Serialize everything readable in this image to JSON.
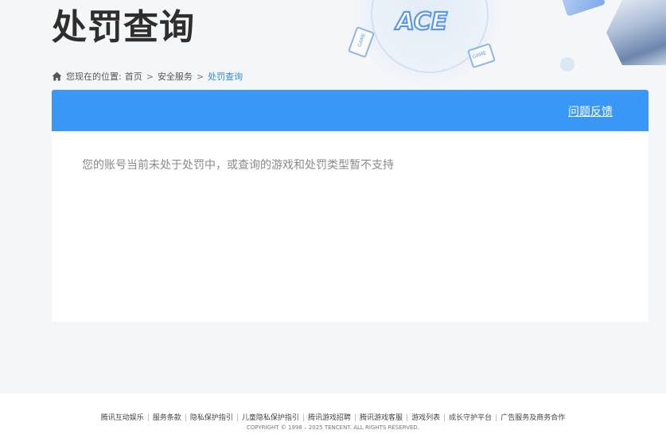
{
  "header": {
    "title": "处罚查询",
    "logo_text": "ACE",
    "card_text_left": "GAME",
    "card_text_right": "GAME"
  },
  "breadcrumb": {
    "icon": "home-icon",
    "prefix": "您现在的位置:",
    "items": [
      "首页",
      "安全服务"
    ],
    "separator": ">",
    "current": "处罚查询"
  },
  "panel": {
    "feedback_label": "问题反馈",
    "message": "您的账号当前未处于处罚中，或查询的游戏和处罚类型暂不支持"
  },
  "footer": {
    "links": [
      "腾讯互动娱乐",
      "服务条款",
      "隐私保护指引",
      "儿童隐私保护指引",
      "腾讯游戏招聘",
      "腾讯游戏客服",
      "游戏列表",
      "成长守护平台",
      "广告服务及商务合作"
    ],
    "link_separator": "|",
    "copyright": "COPYRIGHT © 1998 – 2025 TENCENT. ALL RIGHTS RESERVED."
  },
  "colors": {
    "accent": "#3897f7",
    "current_crumb": "#2a8be8",
    "message_text": "#8a8a8a"
  }
}
